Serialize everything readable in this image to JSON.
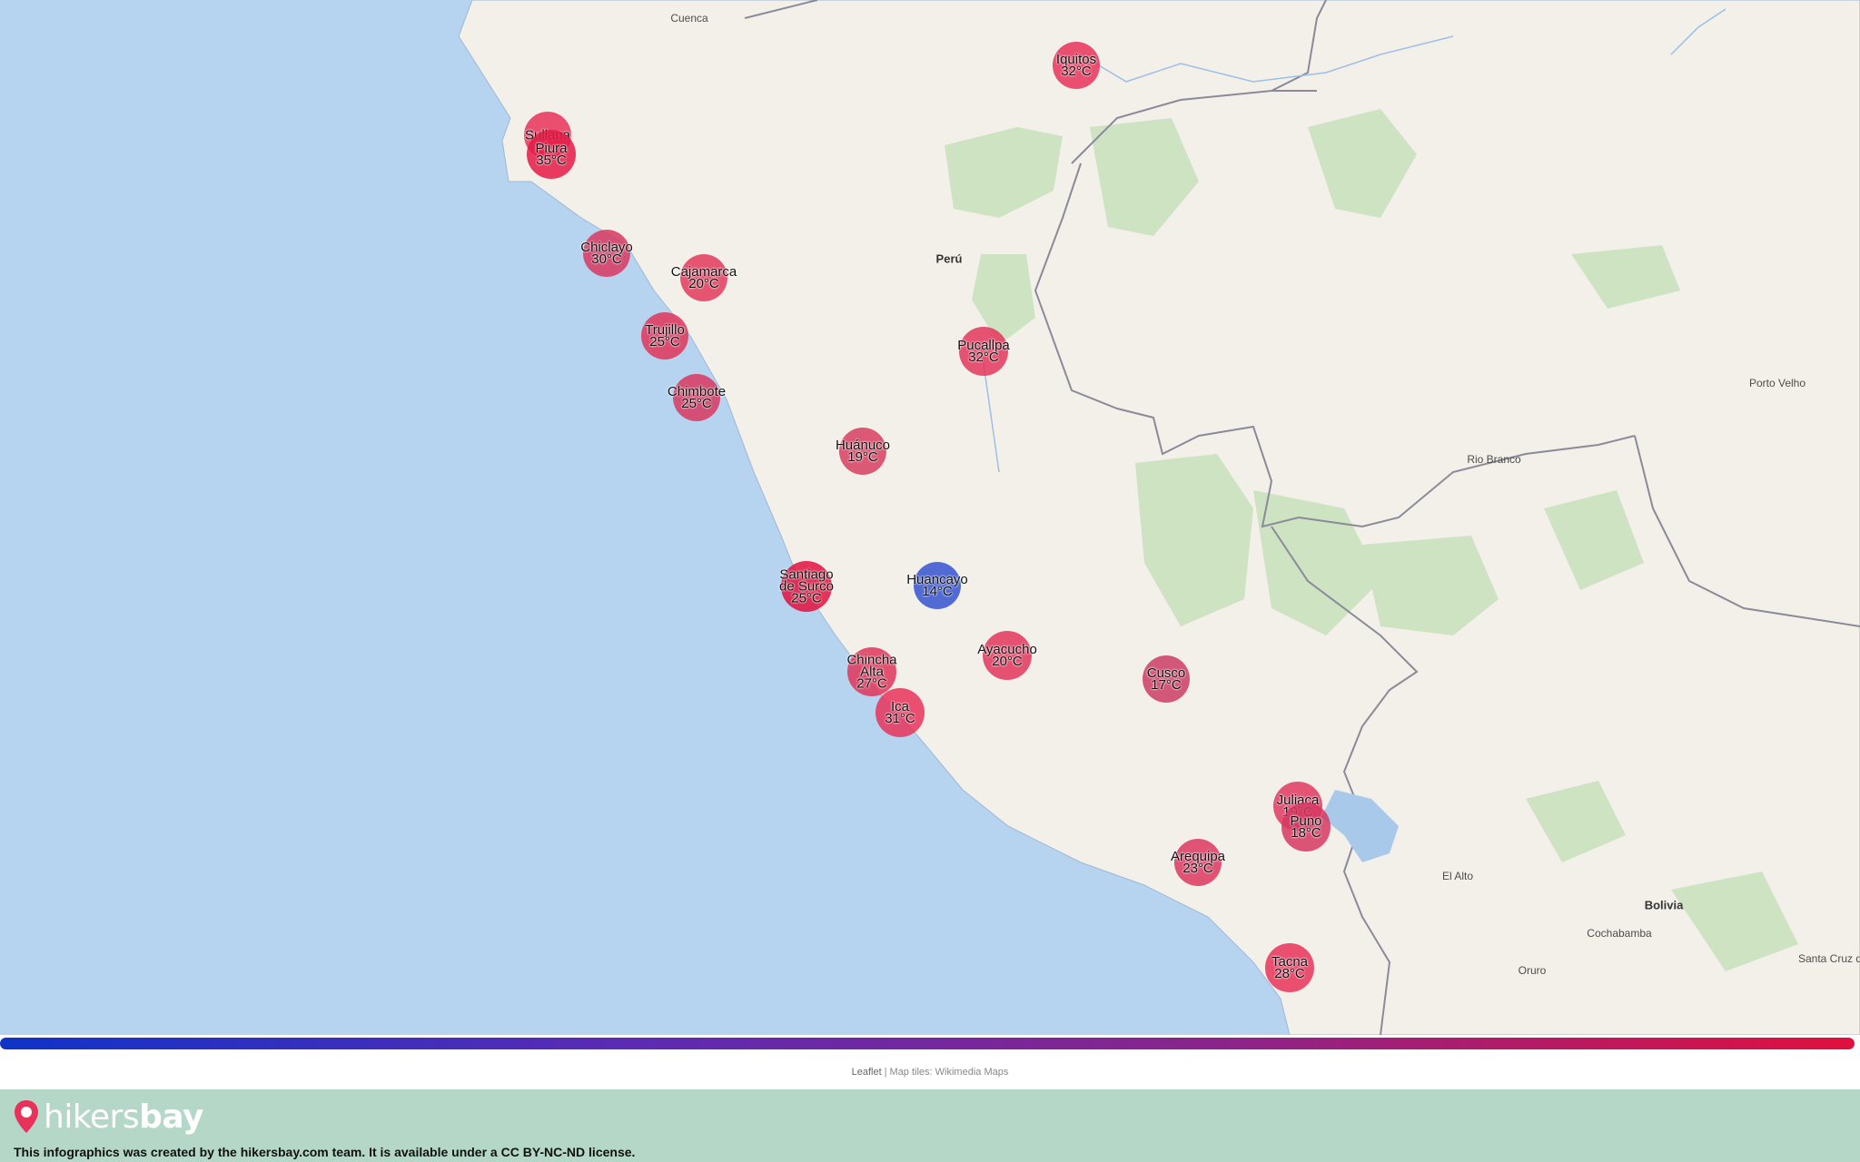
{
  "map": {
    "basemap_labels": [
      {
        "name": "Cuenca"
      },
      {
        "name": "Perú",
        "kind": "country"
      },
      {
        "name": "Porto Velho"
      },
      {
        "name": "Rio Branco"
      },
      {
        "name": "El Alto"
      },
      {
        "name": "Bolivia",
        "kind": "country"
      },
      {
        "name": "Cochabamba"
      },
      {
        "name": "Santa Cruz d"
      },
      {
        "name": "Oruro"
      }
    ],
    "cities": [
      {
        "name": "Iquitos",
        "temp": "32°C",
        "color": "#e8325a"
      },
      {
        "name": "Sullana",
        "temp": "",
        "color": "#e8325a"
      },
      {
        "name": "Piura",
        "temp": "35°C",
        "color": "#e51a45"
      },
      {
        "name": "Chiclayo",
        "temp": "30°C",
        "color": "#d8375f"
      },
      {
        "name": "Cajamarca",
        "temp": "20°C",
        "color": "#e23a5c"
      },
      {
        "name": "Trujillo",
        "temp": "25°C",
        "color": "#e0355b"
      },
      {
        "name": "Chimbote",
        "temp": "25°C",
        "color": "#d8375f"
      },
      {
        "name": "Pucallpa",
        "temp": "32°C",
        "color": "#e3365c"
      },
      {
        "name": "Huánuco",
        "temp": "19°C",
        "color": "#d63e60"
      },
      {
        "name": "Huancayo",
        "temp": "14°C",
        "color": "#3553d0"
      },
      {
        "name": "Santiago de Surco",
        "temp": "25°C",
        "color": "#e0103e"
      },
      {
        "name": "Chincha Alta",
        "temp": "27°C",
        "color": "#e0355b"
      },
      {
        "name": "Ayacucho",
        "temp": "20°C",
        "color": "#e2365c"
      },
      {
        "name": "Ica",
        "temp": "31°C",
        "color": "#e8325a"
      },
      {
        "name": "Cusco",
        "temp": "17°C",
        "color": "#cc3c64"
      },
      {
        "name": "Juliaca",
        "temp": "19°C",
        "color": "#df3860"
      },
      {
        "name": "Puno",
        "temp": "18°C",
        "color": "#d63862"
      },
      {
        "name": "Arequipa",
        "temp": "23°C",
        "color": "#dc3760"
      },
      {
        "name": "Tacna",
        "temp": "28°C",
        "color": "#e8325a"
      }
    ],
    "scale_colors": [
      "#1033c8",
      "#5b2bb3",
      "#8c2489",
      "#e0103e"
    ],
    "ocean_color": "#b6d3ef",
    "land_color": "#f2efe8",
    "attribution": {
      "leaflet": "Leaflet",
      "separator": "|",
      "tiles": "Map tiles: Wikimedia Maps"
    }
  },
  "footer": {
    "logo_text_light": "hikers",
    "logo_text_bold": "bay",
    "license": "This infographics was created by the hikersbay.com team. It is available under a CC BY-NC-ND license.",
    "background": "#b4d7c7"
  }
}
